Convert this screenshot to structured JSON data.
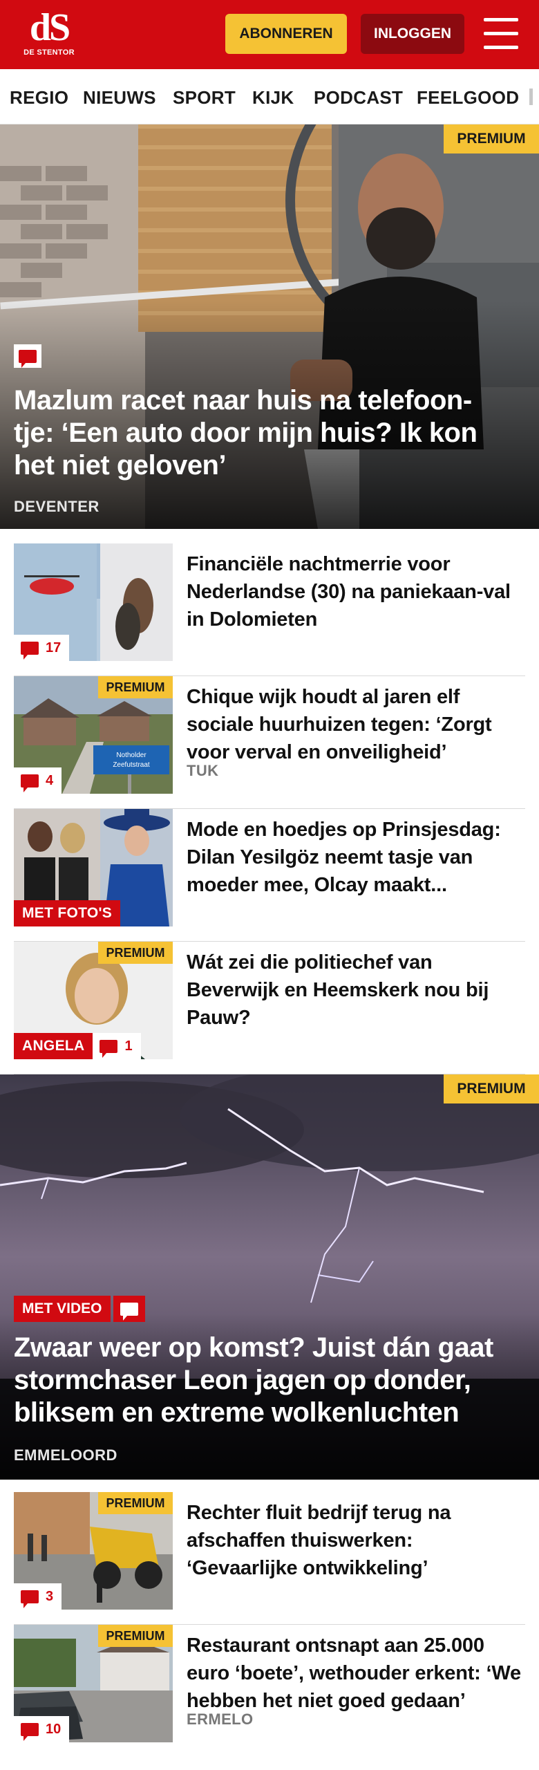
{
  "header": {
    "logo_mark": "dS",
    "logo_text": "DE STENTOR",
    "subscribe_label": "ABONNEREN",
    "login_label": "INLOGGEN",
    "brand_color": "#d10a11",
    "accent_color": "#f5c234"
  },
  "nav": {
    "items": [
      "REGIO",
      "NIEUWS",
      "SPORT",
      "KIJK",
      "PODCAST",
      "FEELGOOD"
    ]
  },
  "top_story": {
    "premium": "PREMIUM",
    "headline": "Mazlum racet naar huis na telefoon-tje: ‘Een auto door mijn huis? Ik kon het niet geloven’",
    "place": "DEVENTER",
    "icon": "comment-icon"
  },
  "list1": [
    {
      "title": "Financiële nachtmerrie voor Nederlandse (30) na paniekaan-val in Dolomieten",
      "comments": "17"
    },
    {
      "title": "Chique wijk houdt al jaren elf sociale huurhuizen tegen: ‘Zorgt voor verval en onveiligheid’",
      "place": "TUK",
      "comments": "4",
      "premium": "PREMIUM",
      "sign_text": "Notholder Zeefutstraat"
    },
    {
      "title": "Mode en hoedjes op Prinsjesdag: Dilan Yesilgöz neemt tasje van moeder mee, Olcay maakt...",
      "tag": "MET FOTO'S"
    },
    {
      "title": "Wát zei die politiechef van Beverwijk en Heemskerk nou bij Pauw?",
      "tag": "ANGELA",
      "comments": "1",
      "premium": "PREMIUM"
    }
  ],
  "second_story": {
    "premium": "PREMIUM",
    "tag": "MET VIDEO",
    "headline": "Zwaar weer op komst? Juist dán gaat stormchaser Leon jagen op donder, bliksem en extreme wolkenluchten",
    "place": "EMMELOORD"
  },
  "list2": [
    {
      "title": "Rechter fluit bedrijf terug na afschaffen thuiswerken: ‘Gevaarlijke ontwikkeling’",
      "comments": "3",
      "premium": "PREMIUM"
    },
    {
      "title": "Restaurant ontsnapt aan 25.000 euro ‘boete’, wethouder erkent: ‘We hebben het niet goed gedaan’",
      "place": "ERMELO",
      "comments": "10",
      "premium": "PREMIUM"
    }
  ]
}
